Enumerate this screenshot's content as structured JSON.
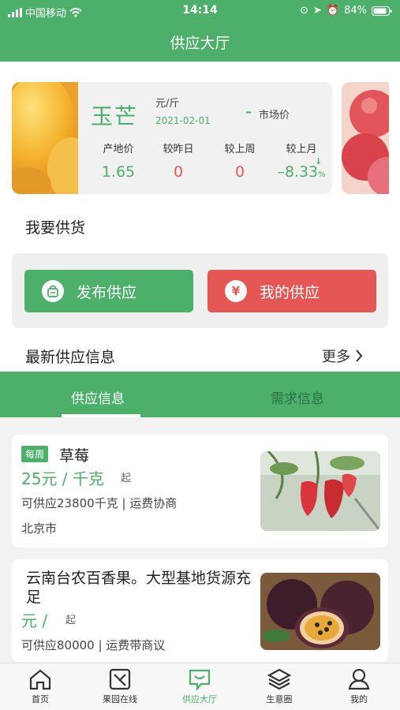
{
  "status_bar": {
    "carrier": "中国移动",
    "time": "14:14",
    "battery": "84%"
  },
  "header": {
    "title": "供应大厅"
  },
  "price_card": {
    "product": "玉芒",
    "unit": "元/斤",
    "date": "2021-02-01",
    "market_dash": "–",
    "market_label": "市场价",
    "stats": [
      {
        "label": "产地价",
        "value": "1.65",
        "color": "#4caf6a"
      },
      {
        "label": "较昨日",
        "value": "0",
        "color": "#e55754"
      },
      {
        "label": "较上周",
        "value": "0",
        "color": "#e55754"
      },
      {
        "label": "较上月",
        "value": "–8.33",
        "color": "#4caf6a"
      }
    ],
    "month_pct_unit": "%"
  },
  "supply": {
    "title": "我要供货",
    "publish_label": "发布供应",
    "mine_label": "我的供应",
    "publish_icon": "bag-icon",
    "mine_icon": "yuan-icon"
  },
  "latest": {
    "title": "最新供应信息",
    "more_label": "更多"
  },
  "tabs": [
    {
      "label": "供应信息",
      "active": true
    },
    {
      "label": "需求信息",
      "active": false
    }
  ],
  "listings": [
    {
      "badge": "每周",
      "name": "草莓",
      "price": "25元 / 千克",
      "qi": "起",
      "supply": "可供应23800千克 | 运费协商",
      "city": "北京市"
    },
    {
      "name": "云南台农百香果。大型基地货源充足",
      "price": "元 /",
      "qi": "起",
      "supply": "可供应80000 | 运费带商议"
    }
  ],
  "bottom_nav": [
    {
      "label": "首页",
      "icon": "home-icon",
      "active": false
    },
    {
      "label": "果园在线",
      "icon": "orchard-icon",
      "active": false
    },
    {
      "label": "供应大厅",
      "icon": "chat-icon",
      "active": true
    },
    {
      "label": "生意圈",
      "icon": "layers-icon",
      "active": false
    },
    {
      "label": "我的",
      "icon": "user-icon",
      "active": false
    }
  ]
}
